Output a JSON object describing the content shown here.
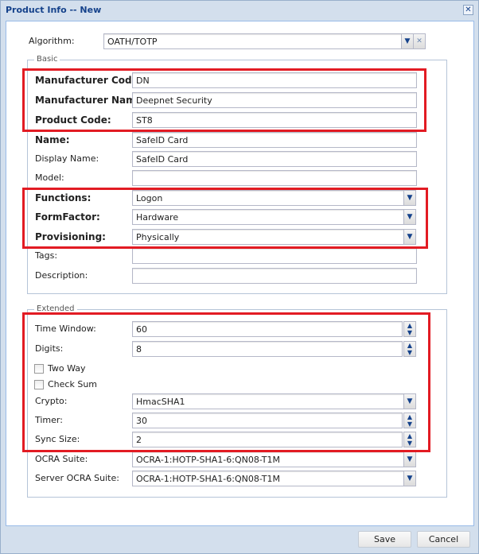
{
  "dialog": {
    "title": "Product Info -- New",
    "close_icon": "close-icon"
  },
  "algorithm": {
    "label": "Algorithm:",
    "value": "OATH/TOTP"
  },
  "basic": {
    "legend": "Basic",
    "fields": [
      {
        "label": "Manufacturer Code:",
        "value": "DN",
        "bold": true,
        "type": "text"
      },
      {
        "label": "Manufacturer Name:",
        "value": "Deepnet Security",
        "bold": true,
        "type": "text"
      },
      {
        "label": "Product Code:",
        "value": "ST8",
        "bold": true,
        "type": "text"
      },
      {
        "label": "Name:",
        "value": "SafeID Card",
        "bold": true,
        "type": "text"
      },
      {
        "label": "Display Name:",
        "value": "SafeID Card",
        "bold": false,
        "type": "text"
      },
      {
        "label": "Model:",
        "value": "",
        "bold": false,
        "type": "text"
      },
      {
        "label": "Functions:",
        "value": "Logon",
        "bold": true,
        "type": "combo"
      },
      {
        "label": "FormFactor:",
        "value": "Hardware",
        "bold": true,
        "type": "combo"
      },
      {
        "label": "Provisioning:",
        "value": "Physically",
        "bold": true,
        "type": "combo"
      },
      {
        "label": "Tags:",
        "value": "",
        "bold": false,
        "type": "text"
      },
      {
        "label": "Description:",
        "value": "",
        "bold": false,
        "type": "text"
      }
    ]
  },
  "extended": {
    "legend": "Extended",
    "time_window": {
      "label": "Time Window:",
      "value": "60"
    },
    "digits": {
      "label": "Digits:",
      "value": "8"
    },
    "two_way": {
      "label": "Two Way",
      "checked": false
    },
    "check_sum": {
      "label": "Check Sum",
      "checked": false
    },
    "crypto": {
      "label": "Crypto:",
      "value": "HmacSHA1"
    },
    "timer": {
      "label": "Timer:",
      "value": "30"
    },
    "sync_size": {
      "label": "Sync Size:",
      "value": "2"
    },
    "ocra_suite": {
      "label": "OCRA Suite:",
      "value": "OCRA-1:HOTP-SHA1-6:QN08-T1M"
    },
    "server_ocra_suite": {
      "label": "Server OCRA Suite:",
      "value": "OCRA-1:HOTP-SHA1-6:QN08-T1M"
    }
  },
  "footer": {
    "save": "Save",
    "cancel": "Cancel"
  },
  "highlight_color": "#e21b23"
}
